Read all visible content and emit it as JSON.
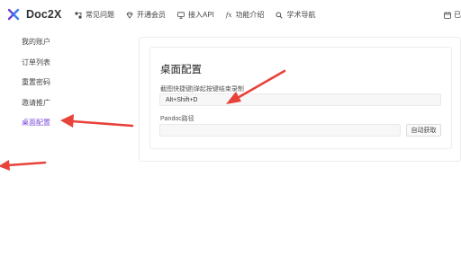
{
  "header": {
    "logo_text": "Doc2X",
    "nav": [
      {
        "icon": "faq-icon",
        "label": "常见问题"
      },
      {
        "icon": "diamond-icon",
        "label": "开通会员"
      },
      {
        "icon": "monitor-icon",
        "label": "接入API"
      },
      {
        "icon": "fx-icon",
        "glyph": "fx",
        "label": "功能介绍"
      },
      {
        "icon": "search-icon",
        "label": "学术导航"
      }
    ],
    "right_partial": "已"
  },
  "sidebar": {
    "items": [
      {
        "label": "我的账户",
        "active": false
      },
      {
        "label": "订单列表",
        "active": false
      },
      {
        "label": "重置密码",
        "active": false
      },
      {
        "label": "邀请推广",
        "active": false
      },
      {
        "label": "桌面配置",
        "active": true
      }
    ]
  },
  "main": {
    "title": "桌面配置",
    "shortcut": {
      "label": "截图快捷键|弹起按键结束录制",
      "value": "Alt+Shift+D"
    },
    "pandoc": {
      "label": "Pandoc路径",
      "value": "",
      "button": "自动获取"
    }
  },
  "colors": {
    "accent": "#7b4bd8",
    "annotation_arrow": "#e8423a"
  }
}
